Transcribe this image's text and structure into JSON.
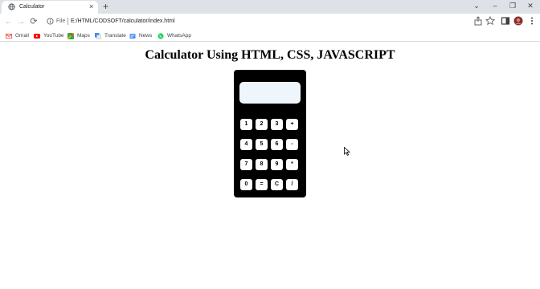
{
  "browser": {
    "tab": {
      "title": "Calculator",
      "close": "×"
    },
    "new_tab": "+",
    "window_controls": {
      "menu": "⌄",
      "minimize": "–",
      "restore": "❐",
      "close": "✕"
    },
    "nav": {
      "back": "←",
      "forward": "→",
      "reload": "⟳"
    },
    "address": {
      "scheme": "File",
      "url": "E:/HTML/CODSOFT/calculator/index.html"
    },
    "icons": [
      "info-icon",
      "share-icon",
      "star-icon",
      "side-panel-icon",
      "profile-avatar-icon",
      "more-menu-icon"
    ],
    "bookmarks": [
      {
        "label": "Gmail",
        "icon": "gmail-icon"
      },
      {
        "label": "YouTube",
        "icon": "youtube-icon"
      },
      {
        "label": "Maps",
        "icon": "maps-icon"
      },
      {
        "label": "Translate",
        "icon": "translate-icon"
      },
      {
        "label": "News",
        "icon": "news-icon"
      },
      {
        "label": "WhatsApp",
        "icon": "whatsapp-icon"
      }
    ]
  },
  "page": {
    "title": "Calculator Using HTML, CSS, JAVASCRIPT",
    "calculator": {
      "display_value": "",
      "keys": [
        [
          "1",
          "2",
          "3",
          "+"
        ],
        [
          "4",
          "5",
          "6",
          "-"
        ],
        [
          "7",
          "8",
          "9",
          "*"
        ],
        [
          "0",
          "=",
          "C",
          "/"
        ]
      ]
    }
  },
  "colors": {
    "tabstrip": "#dee1e6",
    "calculator_body": "#000000",
    "display": "#eef6fb",
    "key": "#ffffff"
  }
}
